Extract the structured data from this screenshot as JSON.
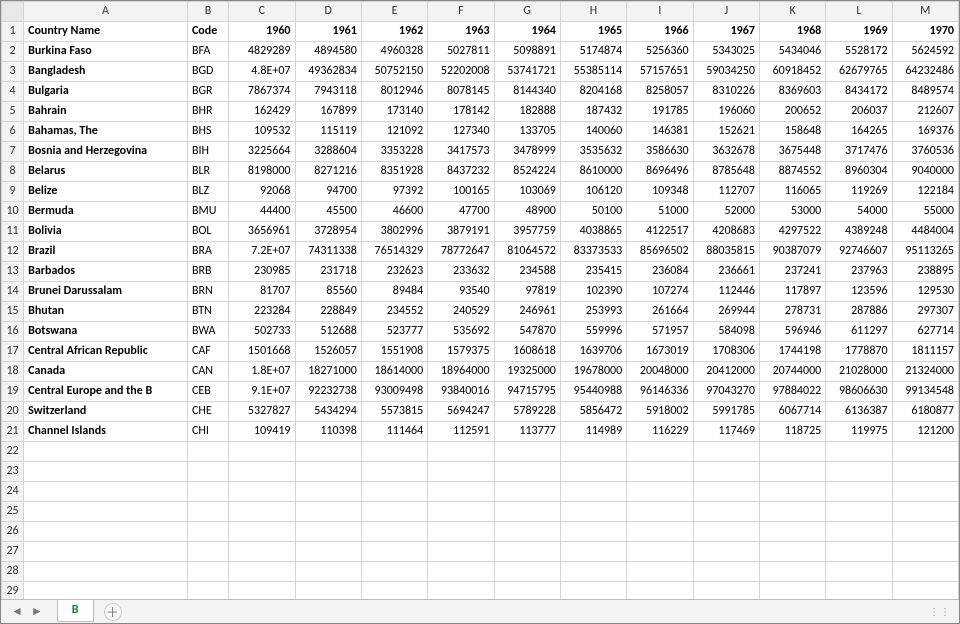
{
  "sheet_tab": "B",
  "columns": [
    "A",
    "B",
    "C",
    "D",
    "E",
    "F",
    "G",
    "H",
    "I",
    "J",
    "K",
    "L",
    "M"
  ],
  "header_row": [
    "Country Name",
    "Code",
    "1960",
    "1961",
    "1962",
    "1963",
    "1964",
    "1965",
    "1966",
    "1967",
    "1968",
    "1969",
    "1970"
  ],
  "rows": [
    [
      "Burkina Faso",
      "BFA",
      "4829289",
      "4894580",
      "4960328",
      "5027811",
      "5098891",
      "5174874",
      "5256360",
      "5343025",
      "5434046",
      "5528172",
      "5624592"
    ],
    [
      "Bangladesh",
      "BGD",
      "4.8E+07",
      "49362834",
      "50752150",
      "52202008",
      "53741721",
      "55385114",
      "57157651",
      "59034250",
      "60918452",
      "62679765",
      "64232486"
    ],
    [
      "Bulgaria",
      "BGR",
      "7867374",
      "7943118",
      "8012946",
      "8078145",
      "8144340",
      "8204168",
      "8258057",
      "8310226",
      "8369603",
      "8434172",
      "8489574"
    ],
    [
      "Bahrain",
      "BHR",
      "162429",
      "167899",
      "173140",
      "178142",
      "182888",
      "187432",
      "191785",
      "196060",
      "200652",
      "206037",
      "212607"
    ],
    [
      "Bahamas, The",
      "BHS",
      "109532",
      "115119",
      "121092",
      "127340",
      "133705",
      "140060",
      "146381",
      "152621",
      "158648",
      "164265",
      "169376"
    ],
    [
      "Bosnia and Herzegovina",
      "BIH",
      "3225664",
      "3288604",
      "3353228",
      "3417573",
      "3478999",
      "3535632",
      "3586630",
      "3632678",
      "3675448",
      "3717476",
      "3760536"
    ],
    [
      "Belarus",
      "BLR",
      "8198000",
      "8271216",
      "8351928",
      "8437232",
      "8524224",
      "8610000",
      "8696496",
      "8785648",
      "8874552",
      "8960304",
      "9040000"
    ],
    [
      "Belize",
      "BLZ",
      "92068",
      "94700",
      "97392",
      "100165",
      "103069",
      "106120",
      "109348",
      "112707",
      "116065",
      "119269",
      "122184"
    ],
    [
      "Bermuda",
      "BMU",
      "44400",
      "45500",
      "46600",
      "47700",
      "48900",
      "50100",
      "51000",
      "52000",
      "53000",
      "54000",
      "55000"
    ],
    [
      "Bolivia",
      "BOL",
      "3656961",
      "3728954",
      "3802996",
      "3879191",
      "3957759",
      "4038865",
      "4122517",
      "4208683",
      "4297522",
      "4389248",
      "4484004"
    ],
    [
      "Brazil",
      "BRA",
      "7.2E+07",
      "74311338",
      "76514329",
      "78772647",
      "81064572",
      "83373533",
      "85696502",
      "88035815",
      "90387079",
      "92746607",
      "95113265"
    ],
    [
      "Barbados",
      "BRB",
      "230985",
      "231718",
      "232623",
      "233632",
      "234588",
      "235415",
      "236084",
      "236661",
      "237241",
      "237963",
      "238895"
    ],
    [
      "Brunei Darussalam",
      "BRN",
      "81707",
      "85560",
      "89484",
      "93540",
      "97819",
      "102390",
      "107274",
      "112446",
      "117897",
      "123596",
      "129530"
    ],
    [
      "Bhutan",
      "BTN",
      "223284",
      "228849",
      "234552",
      "240529",
      "246961",
      "253993",
      "261664",
      "269944",
      "278731",
      "287886",
      "297307"
    ],
    [
      "Botswana",
      "BWA",
      "502733",
      "512688",
      "523777",
      "535692",
      "547870",
      "559996",
      "571957",
      "584098",
      "596946",
      "611297",
      "627714"
    ],
    [
      "Central African Republic",
      "CAF",
      "1501668",
      "1526057",
      "1551908",
      "1579375",
      "1608618",
      "1639706",
      "1673019",
      "1708306",
      "1744198",
      "1778870",
      "1811157"
    ],
    [
      "Canada",
      "CAN",
      "1.8E+07",
      "18271000",
      "18614000",
      "18964000",
      "19325000",
      "19678000",
      "20048000",
      "20412000",
      "20744000",
      "21028000",
      "21324000"
    ],
    [
      "Central Europe and the B",
      "CEB",
      "9.1E+07",
      "92232738",
      "93009498",
      "93840016",
      "94715795",
      "95440988",
      "96146336",
      "97043270",
      "97884022",
      "98606630",
      "99134548"
    ],
    [
      "Switzerland",
      "CHE",
      "5327827",
      "5434294",
      "5573815",
      "5694247",
      "5789228",
      "5856472",
      "5918002",
      "5991785",
      "6067714",
      "6136387",
      "6180877"
    ],
    [
      "Channel Islands",
      "CHI",
      "109419",
      "110398",
      "111464",
      "112591",
      "113777",
      "114989",
      "116229",
      "117469",
      "118725",
      "119975",
      "121200"
    ]
  ],
  "blank_rows_after": 8,
  "chart_data": {
    "type": "table",
    "title": "Country population by year",
    "columns": [
      "Country Name",
      "Code",
      "1960",
      "1961",
      "1962",
      "1963",
      "1964",
      "1965",
      "1966",
      "1967",
      "1968",
      "1969",
      "1970"
    ],
    "data": [
      {
        "Country Name": "Burkina Faso",
        "Code": "BFA",
        "1960": 4829289,
        "1961": 4894580,
        "1962": 4960328,
        "1963": 5027811,
        "1964": 5098891,
        "1965": 5174874,
        "1966": 5256360,
        "1967": 5343025,
        "1968": 5434046,
        "1969": 5528172,
        "1970": 5624592
      },
      {
        "Country Name": "Bangladesh",
        "Code": "BGD",
        "1960": 48000000,
        "1961": 49362834,
        "1962": 50752150,
        "1963": 52202008,
        "1964": 53741721,
        "1965": 55385114,
        "1966": 57157651,
        "1967": 59034250,
        "1968": 60918452,
        "1969": 62679765,
        "1970": 64232486
      },
      {
        "Country Name": "Bulgaria",
        "Code": "BGR",
        "1960": 7867374,
        "1961": 7943118,
        "1962": 8012946,
        "1963": 8078145,
        "1964": 8144340,
        "1965": 8204168,
        "1966": 8258057,
        "1967": 8310226,
        "1968": 8369603,
        "1969": 8434172,
        "1970": 8489574
      },
      {
        "Country Name": "Bahrain",
        "Code": "BHR",
        "1960": 162429,
        "1961": 167899,
        "1962": 173140,
        "1963": 178142,
        "1964": 182888,
        "1965": 187432,
        "1966": 191785,
        "1967": 196060,
        "1968": 200652,
        "1969": 206037,
        "1970": 212607
      },
      {
        "Country Name": "Bahamas, The",
        "Code": "BHS",
        "1960": 109532,
        "1961": 115119,
        "1962": 121092,
        "1963": 127340,
        "1964": 133705,
        "1965": 140060,
        "1966": 146381,
        "1967": 152621,
        "1968": 158648,
        "1969": 164265,
        "1970": 169376
      },
      {
        "Country Name": "Bosnia and Herzegovina",
        "Code": "BIH",
        "1960": 3225664,
        "1961": 3288604,
        "1962": 3353228,
        "1963": 3417573,
        "1964": 3478999,
        "1965": 3535632,
        "1966": 3586630,
        "1967": 3632678,
        "1968": 3675448,
        "1969": 3717476,
        "1970": 3760536
      },
      {
        "Country Name": "Belarus",
        "Code": "BLR",
        "1960": 8198000,
        "1961": 8271216,
        "1962": 8351928,
        "1963": 8437232,
        "1964": 8524224,
        "1965": 8610000,
        "1966": 8696496,
        "1967": 8785648,
        "1968": 8874552,
        "1969": 8960304,
        "1970": 9040000
      },
      {
        "Country Name": "Belize",
        "Code": "BLZ",
        "1960": 92068,
        "1961": 94700,
        "1962": 97392,
        "1963": 100165,
        "1964": 103069,
        "1965": 106120,
        "1966": 109348,
        "1967": 112707,
        "1968": 116065,
        "1969": 119269,
        "1970": 122184
      },
      {
        "Country Name": "Bermuda",
        "Code": "BMU",
        "1960": 44400,
        "1961": 45500,
        "1962": 46600,
        "1963": 47700,
        "1964": 48900,
        "1965": 50100,
        "1966": 51000,
        "1967": 52000,
        "1968": 53000,
        "1969": 54000,
        "1970": 55000
      },
      {
        "Country Name": "Bolivia",
        "Code": "BOL",
        "1960": 3656961,
        "1961": 3728954,
        "1962": 3802996,
        "1963": 3879191,
        "1964": 3957759,
        "1965": 4038865,
        "1966": 4122517,
        "1967": 4208683,
        "1968": 4297522,
        "1969": 4389248,
        "1970": 4484004
      },
      {
        "Country Name": "Brazil",
        "Code": "BRA",
        "1960": 72000000,
        "1961": 74311338,
        "1962": 76514329,
        "1963": 78772647,
        "1964": 81064572,
        "1965": 83373533,
        "1966": 85696502,
        "1967": 88035815,
        "1968": 90387079,
        "1969": 92746607,
        "1970": 95113265
      },
      {
        "Country Name": "Barbados",
        "Code": "BRB",
        "1960": 230985,
        "1961": 231718,
        "1962": 232623,
        "1963": 233632,
        "1964": 234588,
        "1965": 235415,
        "1966": 236084,
        "1967": 236661,
        "1968": 237241,
        "1969": 237963,
        "1970": 238895
      },
      {
        "Country Name": "Brunei Darussalam",
        "Code": "BRN",
        "1960": 81707,
        "1961": 85560,
        "1962": 89484,
        "1963": 93540,
        "1964": 97819,
        "1965": 102390,
        "1966": 107274,
        "1967": 112446,
        "1968": 117897,
        "1969": 123596,
        "1970": 129530
      },
      {
        "Country Name": "Bhutan",
        "Code": "BTN",
        "1960": 223284,
        "1961": 228849,
        "1962": 234552,
        "1963": 240529,
        "1964": 246961,
        "1965": 253993,
        "1966": 261664,
        "1967": 269944,
        "1968": 278731,
        "1969": 287886,
        "1970": 297307
      },
      {
        "Country Name": "Botswana",
        "Code": "BWA",
        "1960": 502733,
        "1961": 512688,
        "1962": 523777,
        "1963": 535692,
        "1964": 547870,
        "1965": 559996,
        "1966": 571957,
        "1967": 584098,
        "1968": 596946,
        "1969": 611297,
        "1970": 627714
      },
      {
        "Country Name": "Central African Republic",
        "Code": "CAF",
        "1960": 1501668,
        "1961": 1526057,
        "1962": 1551908,
        "1963": 1579375,
        "1964": 1608618,
        "1965": 1639706,
        "1966": 1673019,
        "1967": 1708306,
        "1968": 1744198,
        "1969": 1778870,
        "1970": 1811157
      },
      {
        "Country Name": "Canada",
        "Code": "CAN",
        "1960": 18000000,
        "1961": 18271000,
        "1962": 18614000,
        "1963": 18964000,
        "1964": 19325000,
        "1965": 19678000,
        "1966": 20048000,
        "1967": 20412000,
        "1968": 20744000,
        "1969": 21028000,
        "1970": 21324000
      },
      {
        "Country Name": "Central Europe and the Baltics",
        "Code": "CEB",
        "1960": 91000000,
        "1961": 92232738,
        "1962": 93009498,
        "1963": 93840016,
        "1964": 94715795,
        "1965": 95440988,
        "1966": 96146336,
        "1967": 97043270,
        "1968": 97884022,
        "1969": 98606630,
        "1970": 99134548
      },
      {
        "Country Name": "Switzerland",
        "Code": "CHE",
        "1960": 5327827,
        "1961": 5434294,
        "1962": 5573815,
        "1963": 5694247,
        "1964": 5789228,
        "1965": 5856472,
        "1966": 5918002,
        "1967": 5991785,
        "1968": 6067714,
        "1969": 6136387,
        "1970": 6180877
      },
      {
        "Country Name": "Channel Islands",
        "Code": "CHI",
        "1960": 109419,
        "1961": 110398,
        "1962": 111464,
        "1963": 112591,
        "1964": 113777,
        "1965": 114989,
        "1966": 116229,
        "1967": 117469,
        "1968": 118725,
        "1969": 119975,
        "1970": 121200
      }
    ]
  }
}
